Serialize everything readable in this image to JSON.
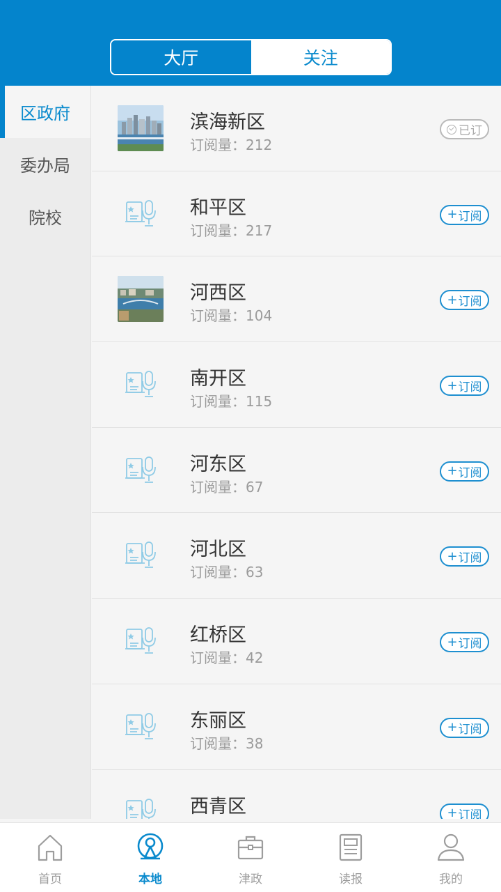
{
  "header": {
    "tabs": [
      {
        "label": "大厅",
        "active": true
      },
      {
        "label": "关注",
        "active": false
      }
    ]
  },
  "sidebar": {
    "items": [
      {
        "label": "区政府",
        "active": true
      },
      {
        "label": "委办局",
        "active": false
      },
      {
        "label": "院校",
        "active": false
      }
    ]
  },
  "list": {
    "items": [
      {
        "name": "滨海新区",
        "count_text": "订阅量：212",
        "button": "已订",
        "subscribed": true,
        "thumb": "photo-city"
      },
      {
        "name": "和平区",
        "count_text": "订阅量：217",
        "button": "订阅",
        "subscribed": false,
        "thumb": "gov-mic-icon"
      },
      {
        "name": "河西区",
        "count_text": "订阅量：104",
        "button": "订阅",
        "subscribed": false,
        "thumb": "photo-river"
      },
      {
        "name": "南开区",
        "count_text": "订阅量：115",
        "button": "订阅",
        "subscribed": false,
        "thumb": "gov-mic-icon"
      },
      {
        "name": "河东区",
        "count_text": "订阅量：67",
        "button": "订阅",
        "subscribed": false,
        "thumb": "gov-mic-icon"
      },
      {
        "name": "河北区",
        "count_text": "订阅量：63",
        "button": "订阅",
        "subscribed": false,
        "thumb": "gov-mic-icon"
      },
      {
        "name": "红桥区",
        "count_text": "订阅量：42",
        "button": "订阅",
        "subscribed": false,
        "thumb": "gov-mic-icon"
      },
      {
        "name": "东丽区",
        "count_text": "订阅量：38",
        "button": "订阅",
        "subscribed": false,
        "thumb": "gov-mic-icon"
      },
      {
        "name": "西青区",
        "count_text": "",
        "button": "订阅",
        "subscribed": false,
        "thumb": "gov-mic-icon"
      }
    ]
  },
  "tabbar": {
    "items": [
      {
        "label": "首页",
        "icon": "home-icon",
        "active": false
      },
      {
        "label": "本地",
        "icon": "local-location-icon",
        "active": true
      },
      {
        "label": "津政",
        "icon": "briefcase-icon",
        "active": false
      },
      {
        "label": "读报",
        "icon": "newspaper-icon",
        "active": false
      },
      {
        "label": "我的",
        "icon": "user-icon",
        "active": false
      }
    ]
  },
  "colors": {
    "primary": "#0484cc",
    "accent_text": "#0a8acd",
    "subscribe_border": "#1e8fd0",
    "subscribed_gray": "#b9b9b9",
    "page_bg": "#f5f5f5",
    "sidebar_bg": "#ececec"
  }
}
